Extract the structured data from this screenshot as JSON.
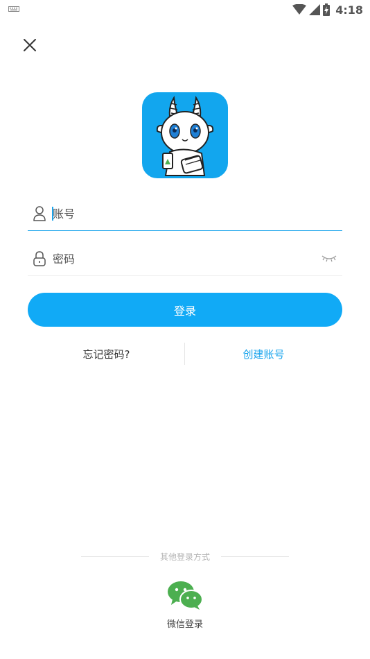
{
  "status_bar": {
    "time": "4:18",
    "icons": [
      "keyboard-icon",
      "wifi-icon",
      "signal-icon",
      "battery-charging-icon"
    ]
  },
  "header": {
    "close_icon": "close-icon"
  },
  "logo": {
    "name": "app-logo-goat-mascot"
  },
  "form": {
    "account": {
      "placeholder": "账号",
      "value": "",
      "icon": "user-icon"
    },
    "password": {
      "placeholder": "密码",
      "value": "",
      "icon": "lock-icon",
      "toggle_icon": "eye-closed-icon"
    }
  },
  "login_button": {
    "label": "登录"
  },
  "links": {
    "forgot": "忘记密码?",
    "create": "创建账号"
  },
  "other_login": {
    "title": "其他登录方式",
    "wechat_label": "微信登录",
    "wechat_icon": "wechat-icon"
  },
  "colors": {
    "primary": "#11aaf6",
    "link": "#1aa4ec",
    "wechat": "#4caf50"
  }
}
